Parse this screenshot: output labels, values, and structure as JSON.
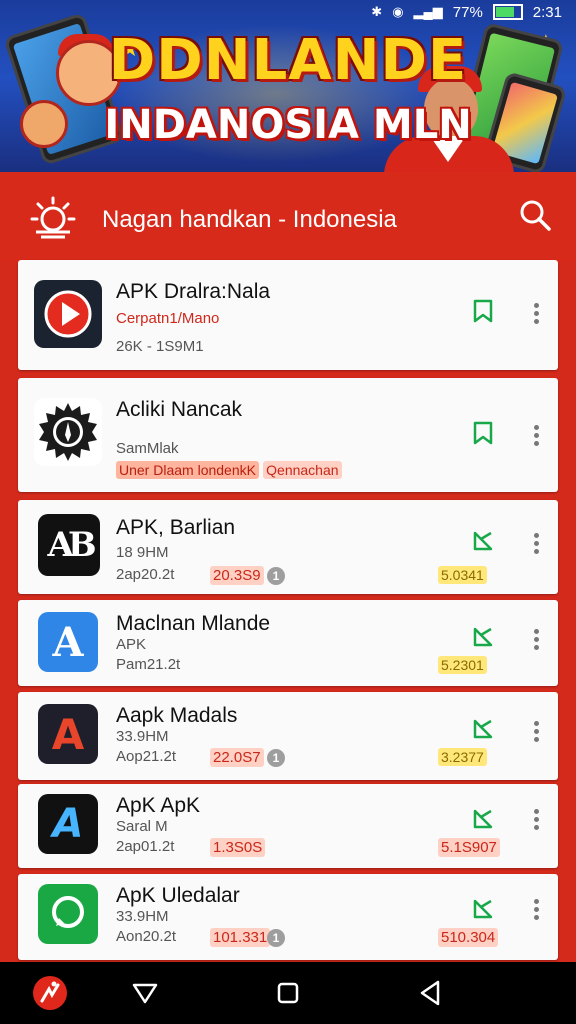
{
  "status_bar": {
    "time": "2:31",
    "battery": "77%",
    "icons": [
      "bluetooth-icon",
      "signal-icon",
      "wifi-icon",
      "battery-icon"
    ]
  },
  "banner": {
    "line1": "DDNLANDE",
    "line2": "INDANOSIA MLN"
  },
  "header": {
    "title": "Nagan handkan -  Indonesia",
    "logo_icon": "sun-logo-icon",
    "search_icon": "search-icon"
  },
  "apps": [
    {
      "name": "APK Dralra:Nala",
      "sub": "Cerpatn1/Mano",
      "meta": "26K - 1S9M1",
      "icon": "play-icon",
      "icon_colors": [
        "#e32b1f",
        "#1c2330"
      ],
      "action": "bookmark-icon"
    },
    {
      "name": "Acliki Nancak",
      "sub": "SamMlak",
      "tag1": "Uner Dlaam londenkK",
      "tag2": "Qennachan",
      "icon": "gear-badge-icon",
      "action": "bookmark-icon"
    },
    {
      "name": "APK, Barlian",
      "sub": "18 9HM",
      "date": "2ap20.2t",
      "price": "20.3S9",
      "rating": "1",
      "score": "5.0341",
      "icon": "ab-logo-icon",
      "action": "shortcut-icon"
    },
    {
      "name": "Maclnan Mlande",
      "sub": "APK",
      "date": "Pam21.2t",
      "score": "5.2301",
      "icon": "a-logo-icon",
      "action": "shortcut-icon"
    },
    {
      "name": "Aapk Madals",
      "sub": "33.9HM",
      "date": "Aop21.2t",
      "price": "22.0S7",
      "rating": "1",
      "score": "3.2377",
      "icon": "a-red-logo-icon",
      "action": "shortcut-icon"
    },
    {
      "name": "ApK ApK",
      "sub": "Saral M",
      "date": "2ap01.2t",
      "price": "1.3S0S",
      "score": "5.1S907",
      "icon": "a-stylized-icon",
      "action": "shortcut-icon"
    },
    {
      "name": "ApK Uledalar",
      "sub": "33.9HM",
      "date": "Aon20.2t",
      "price": "101.331",
      "rating": "1",
      "score": "510.304",
      "icon": "chat-bubble-icon",
      "action": "shortcut-icon"
    }
  ],
  "navbar": {
    "items": [
      "app-logo-icon",
      "back-triangle-icon",
      "home-square-icon",
      "back-arrow-icon"
    ]
  },
  "colors": {
    "primary_red": "#d82a1b",
    "green": "#18a84a",
    "card_bg": "#fafafa"
  }
}
